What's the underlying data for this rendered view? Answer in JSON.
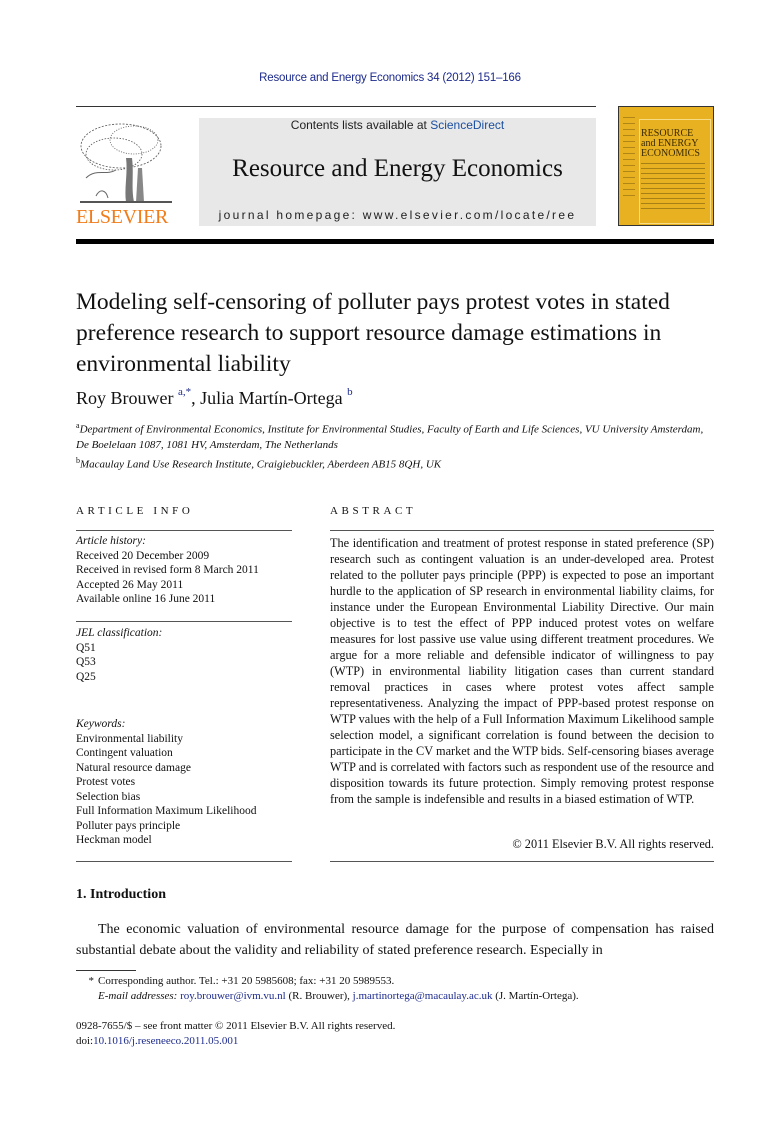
{
  "header": {
    "citation": "Resource and Energy Economics 34 (2012) 151–166",
    "contents_prefix": "Contents lists available at ",
    "contents_link": "ScienceDirect",
    "journal_title": "Resource and Energy Economics",
    "homepage": "journal homepage: www.elsevier.com/locate/ree",
    "publisher_logo_text": "ELSEVIER",
    "cover": {
      "title_lines": [
        "RESOURCE",
        "and ENERGY",
        "ECONOMICS"
      ],
      "color": "#e8b121"
    },
    "publisher_color": "#f07c1a"
  },
  "article": {
    "title": "Modeling self-censoring of polluter pays protest votes in stated preference research to support resource damage estimations in environmental liability",
    "authors": [
      {
        "name": "Roy Brouwer",
        "marks": "a,*"
      },
      {
        "name": "Julia Martín-Ortega",
        "marks": "b"
      }
    ],
    "author_separator": ", ",
    "affiliations": [
      {
        "mark": "a",
        "text": "Department of Environmental Economics, Institute for Environmental Studies, Faculty of Earth and Life Sciences, VU University Amsterdam, De Boelelaan 1087, 1081 HV, Amsterdam, The Netherlands"
      },
      {
        "mark": "b",
        "text": "Macaulay Land Use Research Institute, Craigiebuckler, Aberdeen AB15 8QH, UK"
      }
    ]
  },
  "article_info": {
    "heading": "ARTICLE INFO",
    "history_label": "Article history:",
    "history": [
      "Received 20 December 2009",
      "Received in revised form 8 March 2011",
      "Accepted 26 May 2011",
      "Available online 16 June 2011"
    ],
    "jel_label": "JEL classification:",
    "jel": [
      "Q51",
      "Q53",
      "Q25"
    ],
    "keywords_label": "Keywords:",
    "keywords": [
      "Environmental liability",
      "Contingent valuation",
      "Natural resource damage",
      "Protest votes",
      "Selection bias",
      "Full Information Maximum Likelihood",
      "Polluter pays principle",
      "Heckman model"
    ]
  },
  "abstract": {
    "heading": "ABSTRACT",
    "text": "The identification and treatment of protest response in stated preference (SP) research such as contingent valuation is an under-developed area. Protest related to the polluter pays principle (PPP) is expected to pose an important hurdle to the application of SP research in environmental liability claims, for instance under the European Environmental Liability Directive. Our main objective is to test the effect of PPP induced protest votes on welfare measures for lost passive use value using different treatment procedures. We argue for a more reliable and defensible indicator of willingness to pay (WTP) in environmental liability litigation cases than current standard removal practices in cases where protest votes affect sample representativeness. Analyzing the impact of PPP-based protest response on WTP values with the help of a Full Information Maximum Likelihood sample selection model, a significant correlation is found between the decision to participate in the CV market and the WTP bids. Self-censoring biases average WTP and is correlated with factors such as respondent use of the resource and disposition towards its future protection. Simply removing protest response from the sample is indefensible and results in a biased estimation of WTP.",
    "copyright": "© 2011 Elsevier B.V. All rights reserved."
  },
  "introduction": {
    "heading": "1. Introduction",
    "text": "The economic valuation of environmental resource damage for the purpose of compensation has raised substantial debate about the validity and reliability of stated preference research. Especially in"
  },
  "footnotes": {
    "corresponding_mark": "*",
    "corresponding": "Corresponding author. Tel.: +31 20 5985608; fax: +31 20 5989553.",
    "email_label": "E-mail addresses: ",
    "emails": [
      {
        "address": "roy.brouwer@ivm.vu.nl",
        "owner": " (R. Brouwer), "
      },
      {
        "address": "j.martinortega@macaulay.ac.uk",
        "owner": " (J. Martín-Ortega)."
      }
    ]
  },
  "front_matter": {
    "issn_line": "0928-7655/$ – see front matter © 2011 Elsevier B.V. All rights reserved.",
    "doi_prefix": "doi:",
    "doi": "10.1016/j.reseneeco.2011.05.001"
  }
}
